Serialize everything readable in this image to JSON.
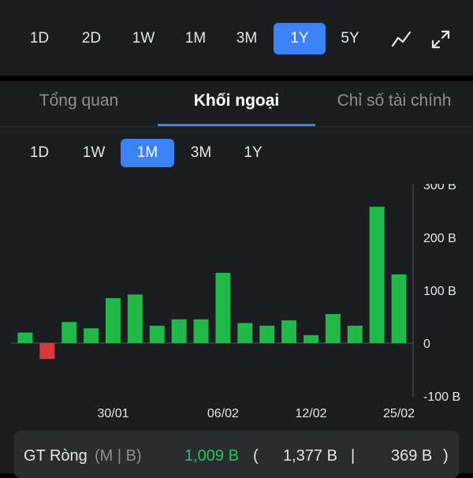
{
  "range_bar": {
    "buttons": [
      "1D",
      "2D",
      "1W",
      "1M",
      "3M",
      "1Y",
      "5Y"
    ],
    "active": "1Y",
    "line_icon": "line-chart-icon",
    "expand_icon": "expand-icon"
  },
  "tabs": {
    "items": [
      "Tổng quan",
      "Khối ngoại",
      "Chỉ số tài chính"
    ],
    "active": "Khối ngoại"
  },
  "sub_range": {
    "buttons": [
      "1D",
      "1W",
      "1M",
      "3M",
      "1Y"
    ],
    "active": "1M"
  },
  "chart_data": {
    "type": "bar",
    "values": [
      20,
      -30,
      40,
      28,
      85,
      92,
      33,
      45,
      45,
      133,
      38,
      33,
      43,
      15,
      55,
      33,
      258,
      130
    ],
    "x_tick_labels": [
      "30/01",
      "06/02",
      "12/02",
      "25/02"
    ],
    "x_tick_after_bar": [
      4,
      9,
      13,
      17
    ],
    "y_ticks": [
      300,
      200,
      100,
      0,
      -100
    ],
    "y_tick_labels": [
      "300 B",
      "200 B",
      "100 B",
      "0",
      "-100 B"
    ],
    "ylim": [
      -100,
      300
    ],
    "positive_color": "#22b84a",
    "negative_color": "#d83a3a",
    "grid": false
  },
  "summary": {
    "label": "GT Ròng",
    "unit": "(M | B)",
    "net_value": "1,009 B",
    "open_paren": "(",
    "buy_value": "1,377 B",
    "separator": "|",
    "sell_value": "369 B",
    "close_paren": ")"
  },
  "colors": {
    "accent": "#3b82f6",
    "positive": "#22c55e",
    "negative": "#d83a3a",
    "panel": "#1b1d20"
  }
}
